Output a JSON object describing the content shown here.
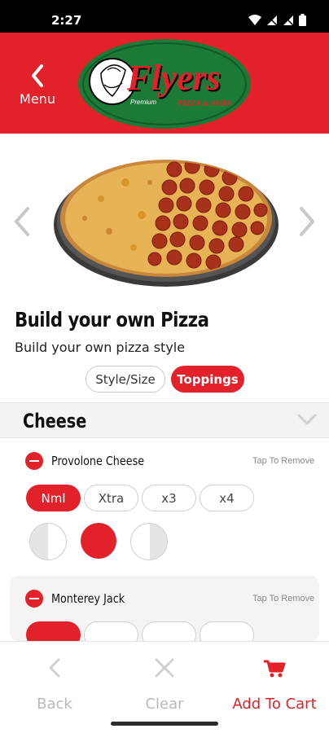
{
  "status_bar": {
    "time": "2:27"
  },
  "header": {
    "menu_label": "Menu",
    "logo": {
      "brand": "Flyers",
      "tagline": "PIZZA & SUBS",
      "premium": "Premium"
    }
  },
  "product": {
    "title": "Build your own Pizza",
    "subtitle": "Build your own pizza style"
  },
  "tabs": [
    {
      "label": "Style/Size",
      "active": false
    },
    {
      "label": "Toppings",
      "active": true
    }
  ],
  "section": {
    "title": "Cheese"
  },
  "toppings": [
    {
      "name": "Provolone Cheese",
      "action": "Tap To Remove",
      "amounts": [
        "Nml",
        "Xtra",
        "x3",
        "x4"
      ],
      "selected_amount": "Nml",
      "placement_options": [
        "left-half",
        "whole",
        "right-half"
      ],
      "selected_placement": "whole"
    },
    {
      "name": "Monterey Jack",
      "action": "Tap To Remove"
    }
  ],
  "bottom_bar": {
    "back": "Back",
    "clear": "Clear",
    "add_to_cart": "Add To Cart"
  },
  "colors": {
    "brand_red": "#e3212a",
    "logo_green": "#1a7a36",
    "muted": "#c8c8c8"
  }
}
